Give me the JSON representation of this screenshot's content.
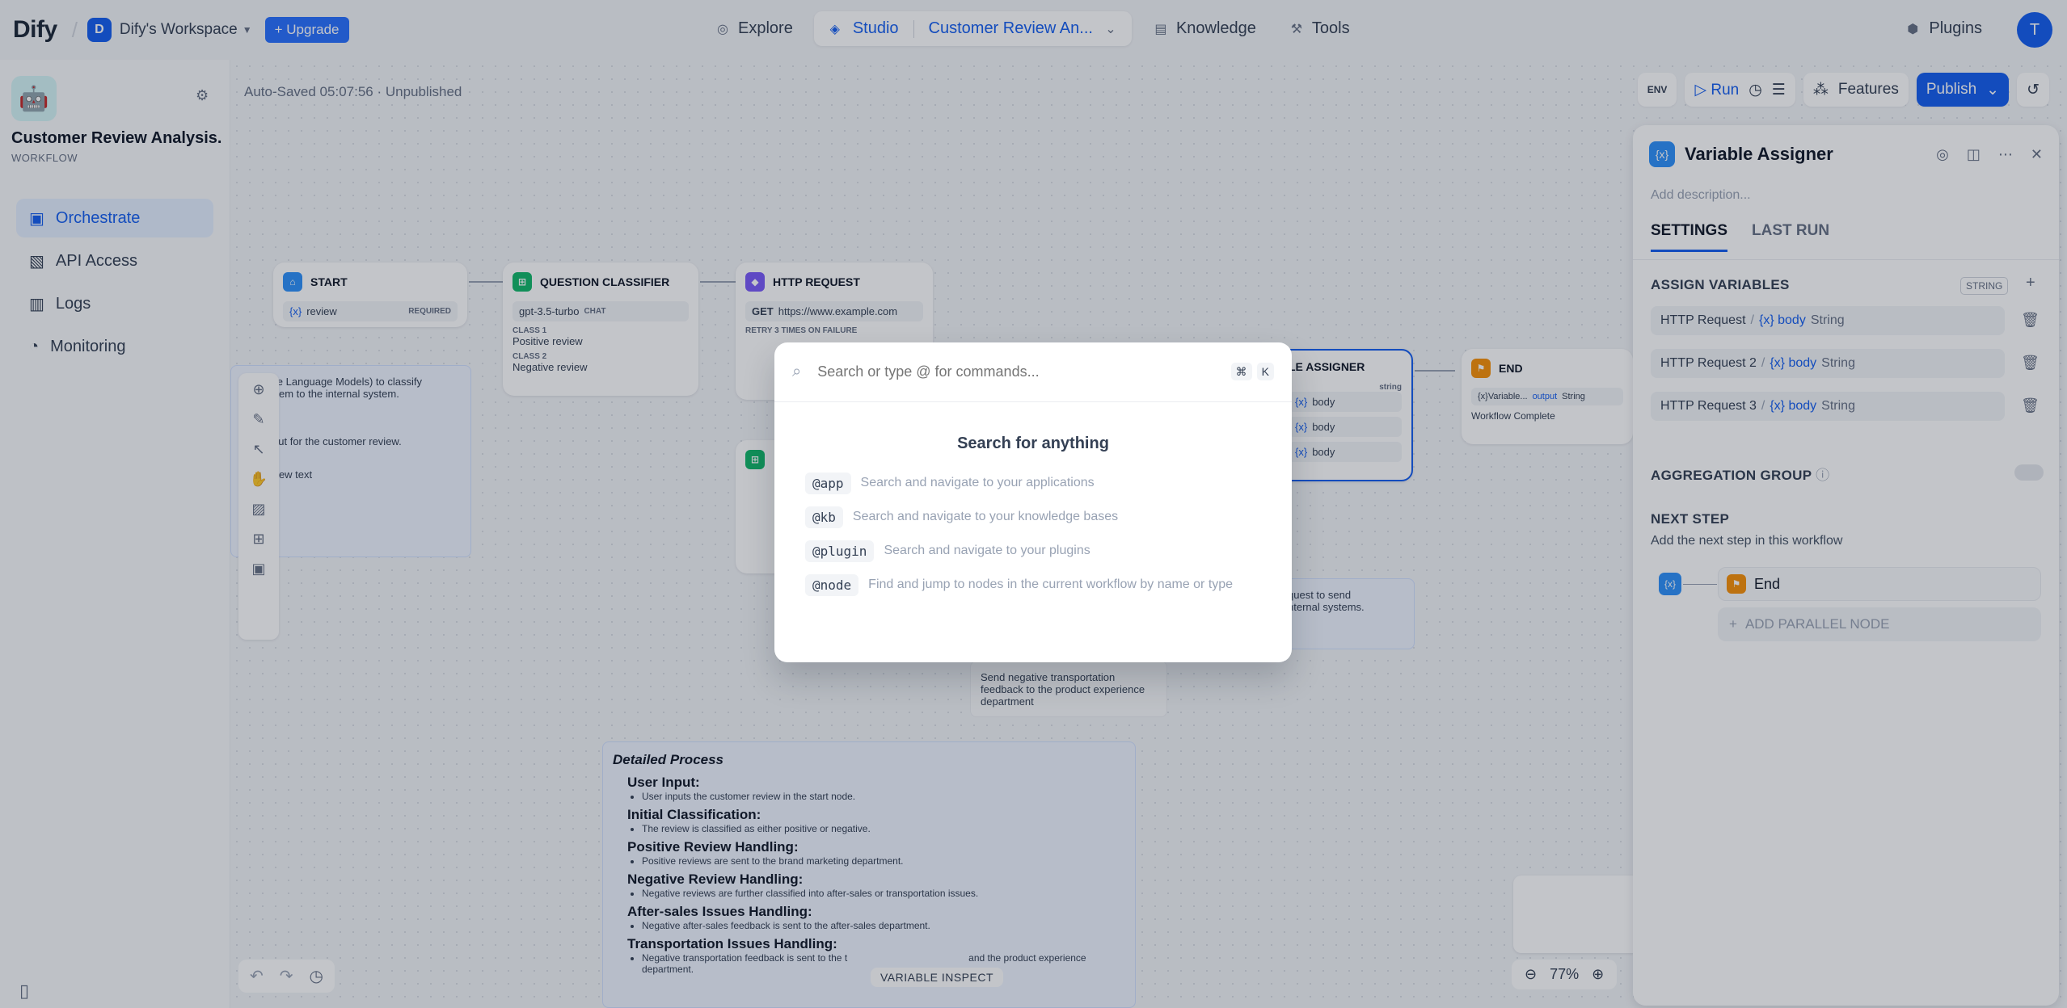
{
  "topbar": {
    "logo": "Dify",
    "workspace_initial": "D",
    "workspace_name": "Dify's Workspace",
    "upgrade_label": "Upgrade",
    "nav": {
      "explore": "Explore",
      "studio": "Studio",
      "current_app": "Customer Review An...",
      "knowledge": "Knowledge",
      "tools": "Tools"
    },
    "plugins_label": "Plugins",
    "user_initial": "T"
  },
  "sidebar": {
    "app_title": "Customer Review Analysis...",
    "app_mode": "WORKFLOW",
    "items": [
      {
        "label": "Orchestrate",
        "icon": "orchestrate-icon",
        "active": true
      },
      {
        "label": "API Access",
        "icon": "api-icon",
        "active": false
      },
      {
        "label": "Logs",
        "icon": "logs-icon",
        "active": false
      },
      {
        "label": "Monitoring",
        "icon": "monitoring-icon",
        "active": false
      }
    ]
  },
  "canvas": {
    "autosaved": "Auto-Saved 05:07:56 · Unpublished",
    "toolbar": {
      "env": "ENV",
      "run": "Run",
      "features": "Features",
      "publish": "Publish"
    },
    "nodes": {
      "start": {
        "title": "START",
        "var": "review",
        "required": "REQUIRED"
      },
      "classifier": {
        "title": "QUESTION CLASSIFIER",
        "model": "gpt-3.5-turbo",
        "model_badge": "CHAT",
        "class1_label": "CLASS 1",
        "class1": "Positive review",
        "class2_label": "CLASS 2",
        "class2": "Negative review"
      },
      "http": {
        "title": "HTTP REQUEST",
        "method": "GET",
        "url": "https://www.example.com",
        "retry": "RETRY 3 TIMES ON FAILURE"
      },
      "assigner": {
        "title": "LE ASSIGNER",
        "vars": [
          "body",
          "body",
          "body"
        ],
        "type": "string"
      },
      "end": {
        "title": "END",
        "var_src": "{x}Variable...",
        "var_name": "output",
        "var_type": "String",
        "desc": "Workflow Complete"
      }
    },
    "notes": {
      "left_lines": [
        "M (Large Language Models) to classify",
        "rward them to the internal system.",
        "user input for the customer review.",
        "mer review text"
      ],
      "right_lines": [
        "quest to send",
        "nternal systems."
      ],
      "transport": "Send negative transportation feedback to the product experience department",
      "process_title": "Detailed Process",
      "process": [
        {
          "h": "User Input:",
          "d": "User inputs the customer review in the start node."
        },
        {
          "h": "Initial Classification:",
          "d": "The review is classified as either positive or negative."
        },
        {
          "h": "Positive Review Handling:",
          "d": "Positive reviews are sent to the brand marketing department."
        },
        {
          "h": "Negative Review Handling:",
          "d": "Negative reviews are further classified into after-sales or transportation issues."
        },
        {
          "h": "After-sales Issues Handling:",
          "d": "Negative after-sales feedback is sent to the after-sales department."
        },
        {
          "h": "Transportation Issues Handling:",
          "d": "Negative transportation feedback is sent to the t"
        }
      ],
      "process_tail": "and the product experience department."
    },
    "zoom": "77%",
    "variable_inspect": "VARIABLE INSPECT"
  },
  "panel": {
    "title": "Variable Assigner",
    "description_placeholder": "Add description...",
    "tabs": [
      "SETTINGS",
      "LAST RUN"
    ],
    "assign_title": "ASSIGN VARIABLES",
    "assign_type": "STRING",
    "variables": [
      {
        "source": "HTTP Request",
        "var": "body",
        "type": "String"
      },
      {
        "source": "HTTP Request 2",
        "var": "body",
        "type": "String"
      },
      {
        "source": "HTTP Request 3",
        "var": "body",
        "type": "String"
      }
    ],
    "aggregation_title": "AGGREGATION GROUP",
    "next_title": "NEXT STEP",
    "next_subtitle": "Add the next step in this workflow",
    "next_node": "End",
    "add_parallel": "ADD PARALLEL NODE"
  },
  "command_palette": {
    "placeholder": "Search or type @ for commands...",
    "shortcut_mod": "⌘",
    "shortcut_key": "K",
    "heading": "Search for anything",
    "commands": [
      {
        "tag": "@app",
        "desc": "Search and navigate to your applications"
      },
      {
        "tag": "@kb",
        "desc": "Search and navigate to your knowledge bases"
      },
      {
        "tag": "@plugin",
        "desc": "Search and navigate to your plugins"
      },
      {
        "tag": "@node",
        "desc": "Find and jump to nodes in the current workflow by name or type"
      }
    ]
  },
  "colors": {
    "accent": "#155eef",
    "overlay": "rgba(16,24,40,0.25)"
  }
}
